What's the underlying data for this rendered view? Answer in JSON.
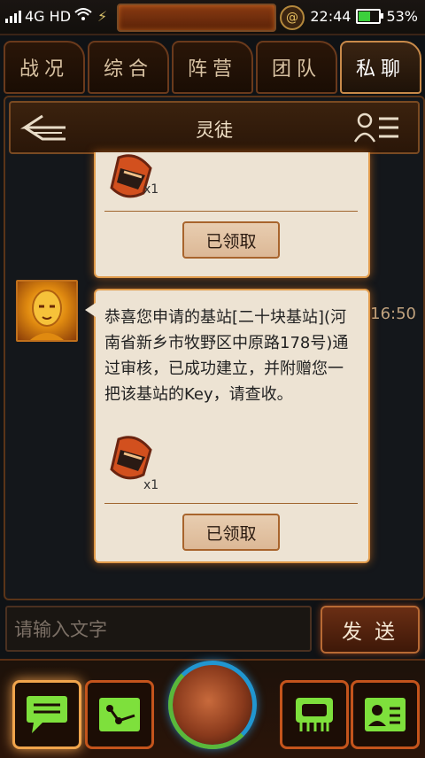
{
  "status_bar": {
    "network": "4G HD",
    "time": "22:44",
    "battery": "53%",
    "battery_level": 0.53
  },
  "tabs": [
    {
      "label": "战况",
      "active": false
    },
    {
      "label": "综合",
      "active": false
    },
    {
      "label": "阵营",
      "active": false
    },
    {
      "label": "团队",
      "active": false
    },
    {
      "label": "私聊",
      "active": true
    }
  ],
  "chat": {
    "title": "灵徒",
    "messages": [
      {
        "item_quantity": "x1",
        "claim_label": "已领取"
      },
      {
        "time": "16:50",
        "text": "恭喜您申请的基站[二十块基站](河南省新乡市牧野区中原路178号)通过审核，已成功建立，并附赠您一把该基站的Key，请查收。",
        "item_quantity": "x1",
        "claim_label": "已领取"
      }
    ]
  },
  "input": {
    "placeholder": "请输入文字",
    "send_label": "发送"
  },
  "bottom_nav": [
    {
      "icon": "chat-icon",
      "active": true
    },
    {
      "icon": "network-icon",
      "active": false
    },
    {
      "icon": "globe-icon",
      "active": false
    },
    {
      "icon": "device-icon",
      "active": false
    },
    {
      "icon": "profile-card-icon",
      "active": false
    }
  ],
  "colors": {
    "accent_orange": "#e09a4a",
    "bubble_bg": "#ede3d3",
    "nav_icon_green": "#7ee03c",
    "globe_blue": "#2196d0"
  }
}
